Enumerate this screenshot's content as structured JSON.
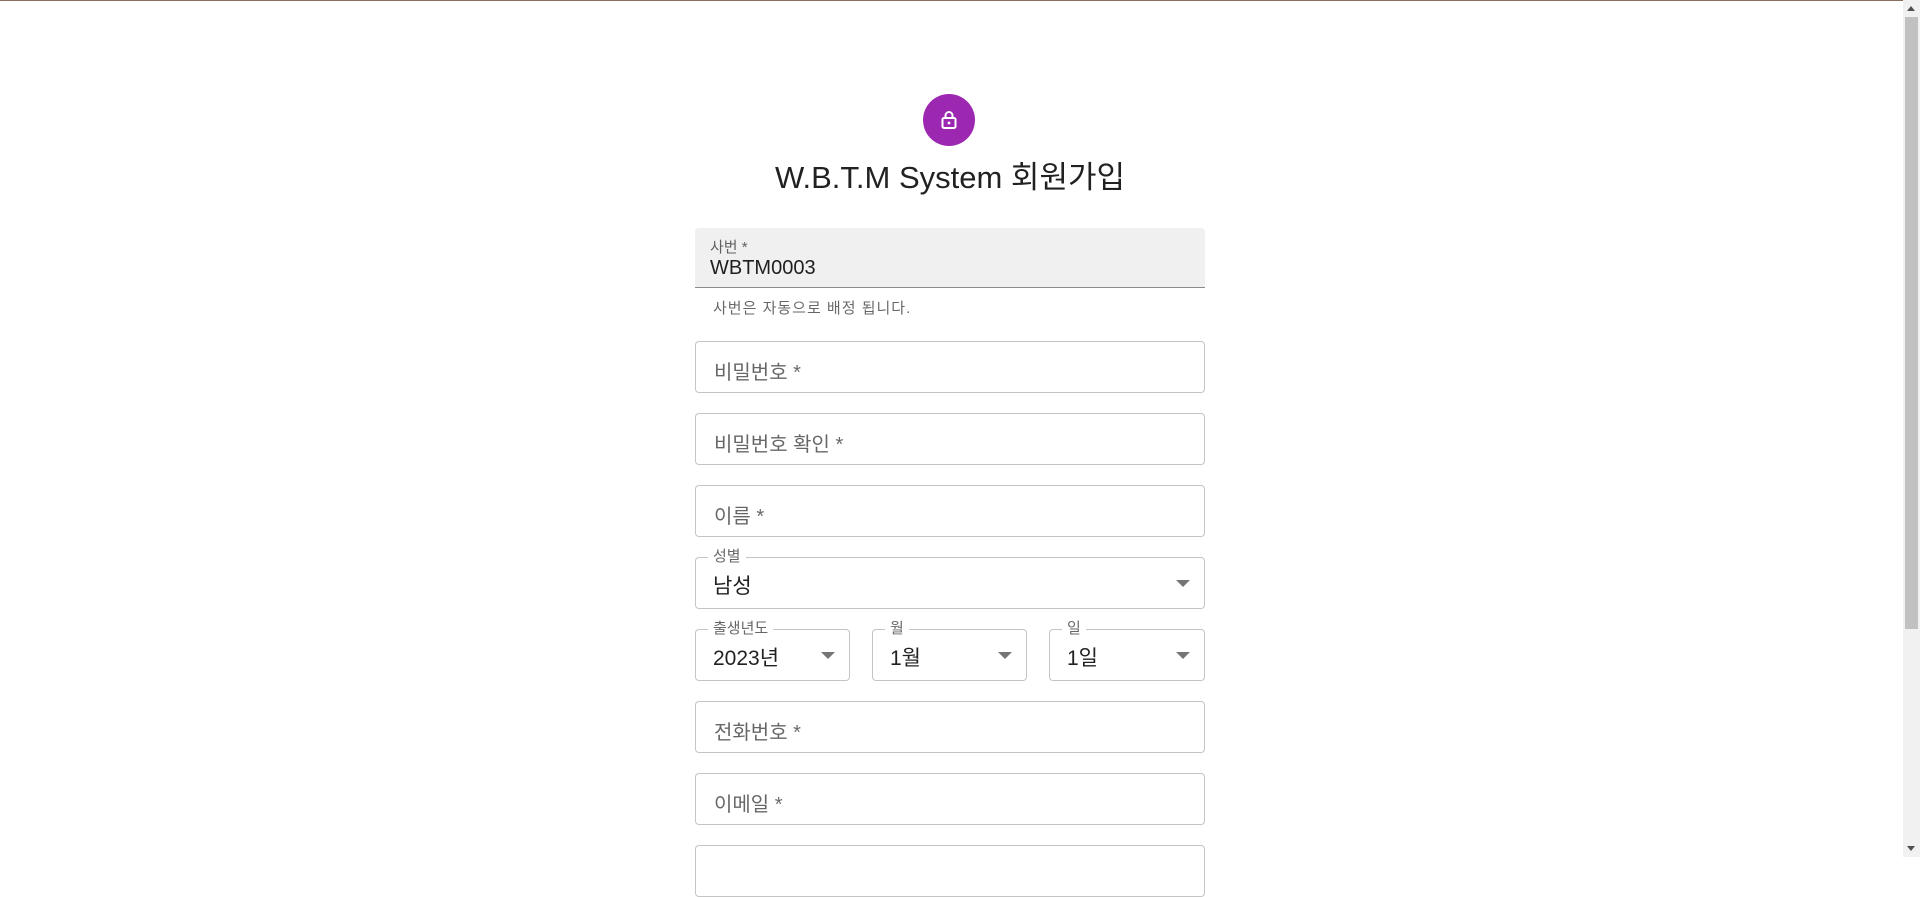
{
  "form": {
    "title": "W.B.T.M System 회원가입",
    "employee_id": {
      "label": "사번 *",
      "value": "WBTM0003",
      "helper": "사번은 자동으로 배정 됩니다."
    },
    "password": {
      "placeholder": "비밀번호 *"
    },
    "password_confirm": {
      "placeholder": "비밀번호 확인 *"
    },
    "name": {
      "placeholder": "이름 *"
    },
    "gender": {
      "label": "성별",
      "value": "남성"
    },
    "birth_year": {
      "label": "출생년도",
      "value": "2023년"
    },
    "birth_month": {
      "label": "월",
      "value": "1월"
    },
    "birth_day": {
      "label": "일",
      "value": "1일"
    },
    "phone": {
      "placeholder": "전화번호 *"
    },
    "email": {
      "placeholder": "이메일 *"
    }
  },
  "icons": {
    "avatar": "lock-icon",
    "accent": "#9c27b0"
  }
}
